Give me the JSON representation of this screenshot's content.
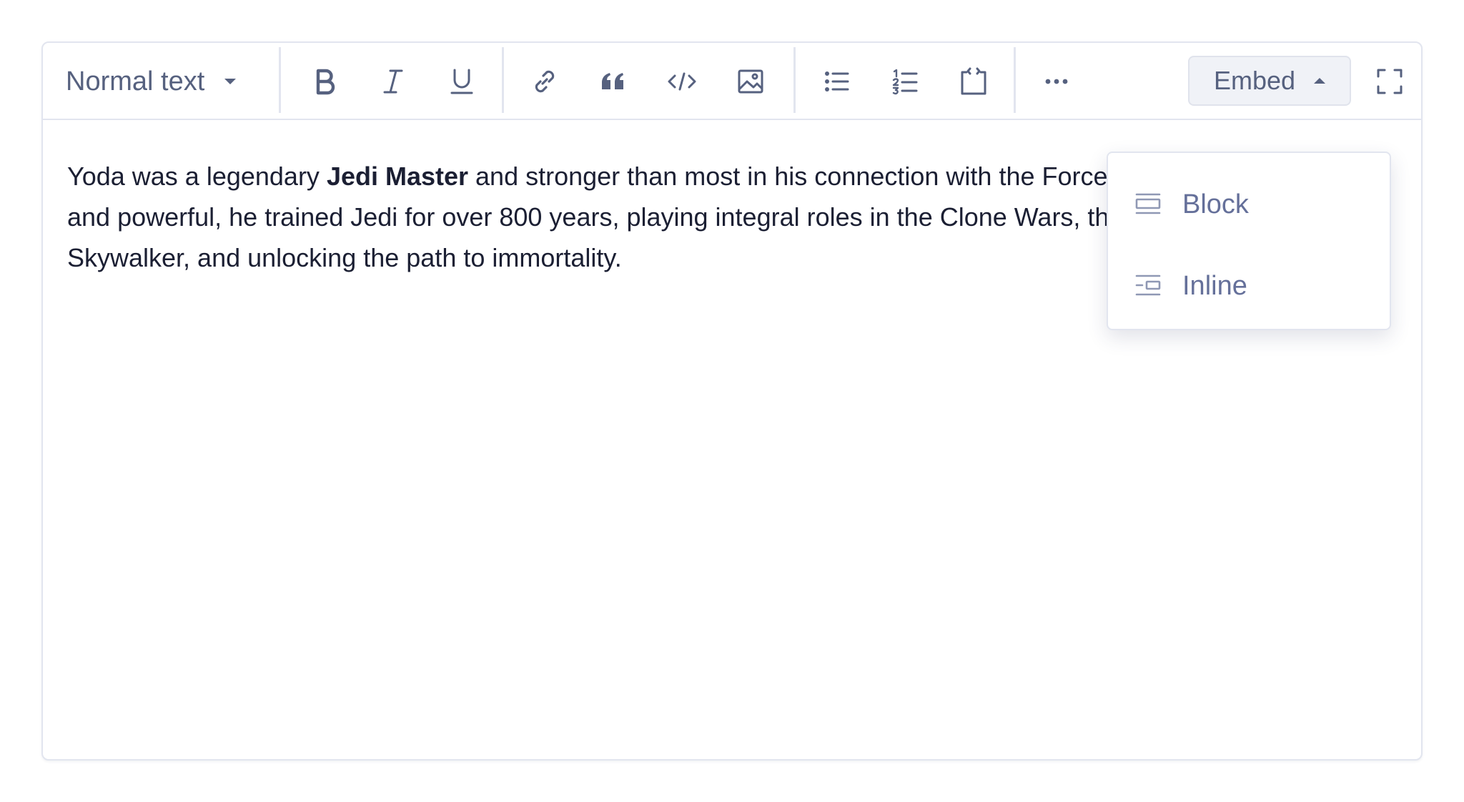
{
  "toolbar": {
    "text_style": "Normal text",
    "buttons": {
      "bold": "bold-icon",
      "italic": "italic-icon",
      "underline": "underline-icon",
      "link": "link-icon",
      "quote": "quote-icon",
      "code": "code-icon",
      "image": "image-icon",
      "bullet_list": "bullet-list-icon",
      "numbered_list": "numbered-list-icon",
      "code_block": "code-block-icon",
      "more": "more-icon",
      "fullscreen": "fullscreen-icon"
    },
    "embed_label": "Embed"
  },
  "content": {
    "before_bold": "Yoda was a legendary ",
    "bold": "Jedi Master",
    "after_bold": " and stronger than most in his connection with the Force. Small in size but wise and powerful, he trained Jedi for over 800 years, playing integral roles in the Clone Wars, the instruction of Luke Skywalker, and unlocking the path to immortality."
  },
  "embed_menu": {
    "items": [
      {
        "label": "Block",
        "icon": "block-embed-icon"
      },
      {
        "label": "Inline",
        "icon": "inline-embed-icon"
      }
    ]
  },
  "colors": {
    "icon": "#56617f",
    "text": "#1b1f33",
    "border": "#e2e5ef",
    "menu_text": "#65709a"
  }
}
